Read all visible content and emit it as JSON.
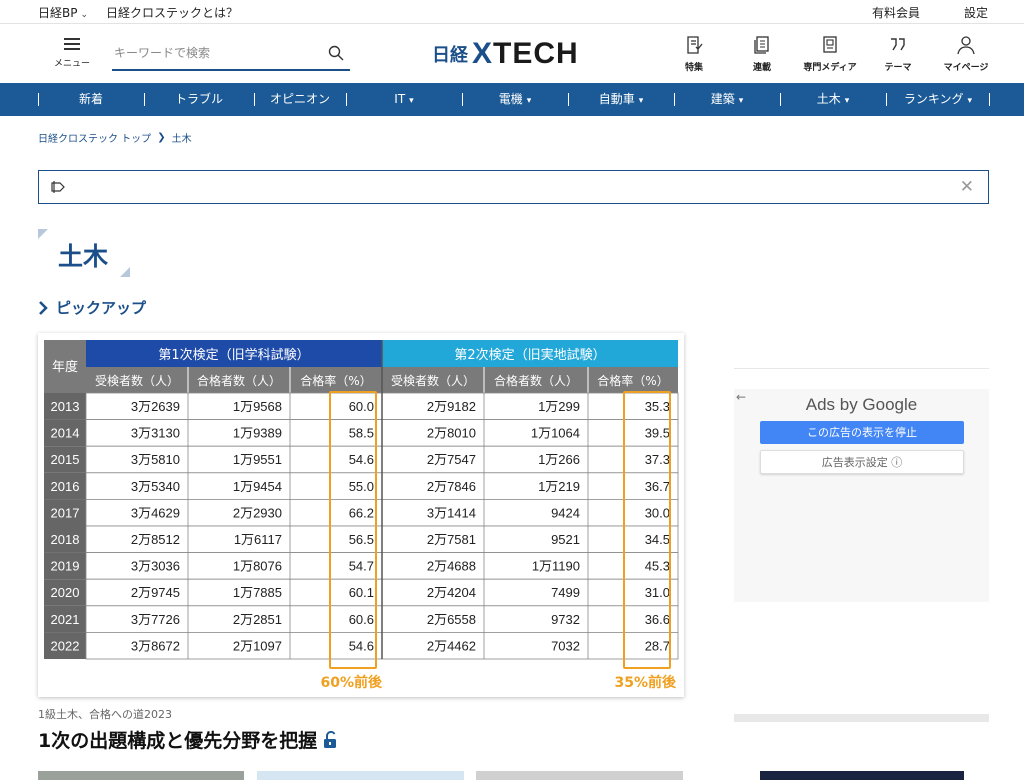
{
  "topbar": {
    "nikkei_bp": "日経BP",
    "about": "日経クロステックとは？",
    "paid_member": "有料会員",
    "settings": "設定"
  },
  "header": {
    "menu_label": "メニュー",
    "search_placeholder": "キーワードで検索",
    "logo_nikkei": "日経",
    "logo_x": "X",
    "logo_tech": "TECH",
    "icons": [
      {
        "name": "feature",
        "label": "特集"
      },
      {
        "name": "series",
        "label": "連載"
      },
      {
        "name": "media",
        "label": "専門メディア"
      },
      {
        "name": "theme",
        "label": "テーマ"
      },
      {
        "name": "mypage",
        "label": "マイページ"
      }
    ]
  },
  "nav": {
    "items": [
      {
        "label": "新着",
        "dropdown": false
      },
      {
        "label": "トラブル",
        "dropdown": false
      },
      {
        "label": "オピニオン",
        "dropdown": false
      },
      {
        "label": "IT",
        "dropdown": true
      },
      {
        "label": "電機",
        "dropdown": true
      },
      {
        "label": "自動車",
        "dropdown": true
      },
      {
        "label": "建築",
        "dropdown": true
      },
      {
        "label": "土木",
        "dropdown": true
      },
      {
        "label": "ランキング",
        "dropdown": true
      }
    ]
  },
  "breadcrumb": {
    "top": "日経クロステック トップ",
    "current": "土木"
  },
  "page_title": "土木",
  "pickup_label": "ピックアップ",
  "article": {
    "caption": "1級土木、合格への道2023",
    "headline": "1次の出題構成と優先分野を把握",
    "table": {
      "year_header": "年度",
      "group1": "第1次検定（旧学科試験）",
      "group2": "第2次検定（旧実地試験）",
      "subheaders": [
        "受検者数（人）",
        "合格者数（人）",
        "合格率（%）",
        "受検者数（人）",
        "合格者数（人）",
        "合格率（%）"
      ],
      "rows": [
        [
          "2013",
          "3万2639",
          "1万9568",
          "60.0",
          "2万9182",
          "1万299",
          "35.3"
        ],
        [
          "2014",
          "3万3130",
          "1万9389",
          "58.5",
          "2万8010",
          "1万1064",
          "39.5"
        ],
        [
          "2015",
          "3万5810",
          "1万9551",
          "54.6",
          "2万7547",
          "1万266",
          "37.3"
        ],
        [
          "2016",
          "3万5340",
          "1万9454",
          "55.0",
          "2万7846",
          "1万219",
          "36.7"
        ],
        [
          "2017",
          "3万4629",
          "2万2930",
          "66.2",
          "3万1414",
          "9424",
          "30.0"
        ],
        [
          "2018",
          "2万8512",
          "1万6117",
          "56.5",
          "2万7581",
          "9521",
          "34.5"
        ],
        [
          "2019",
          "3万3036",
          "1万8076",
          "54.7",
          "2万4688",
          "1万1190",
          "45.3"
        ],
        [
          "2020",
          "2万9745",
          "1万7885",
          "60.1",
          "2万4204",
          "7499",
          "31.0"
        ],
        [
          "2021",
          "3万7726",
          "2万2851",
          "60.6",
          "2万6558",
          "9732",
          "36.6"
        ],
        [
          "2022",
          "3万8672",
          "2万1097",
          "54.6",
          "2万4462",
          "7032",
          "28.7"
        ]
      ],
      "note1": "60%前後",
      "note2": "35%前後"
    }
  },
  "ad": {
    "back": "←",
    "ads_by": "Ads by Google",
    "stop": "この広告の表示を停止",
    "settings": "広告表示設定 ⓘ"
  },
  "colors": {
    "brand_blue": "#1b5a96",
    "group1_bg": "#1e4aa8",
    "group2_bg": "#21a7d8",
    "subheader_bg": "#7a7a7a",
    "highlight": "#f0a020"
  }
}
